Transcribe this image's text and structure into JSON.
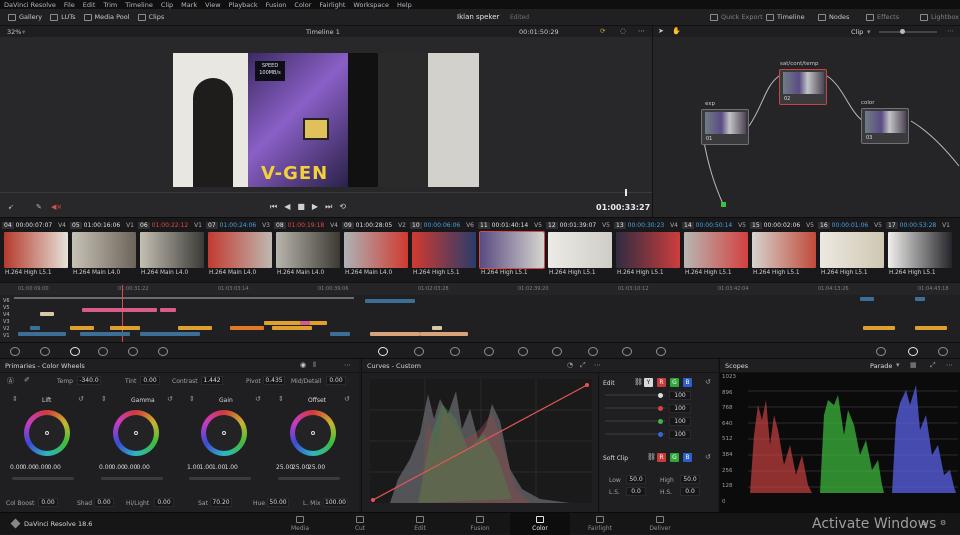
{
  "menu": [
    "DaVinci Resolve",
    "File",
    "Edit",
    "Trim",
    "Timeline",
    "Clip",
    "Mark",
    "View",
    "Playback",
    "Fusion",
    "Color",
    "Fairlight",
    "Workspace",
    "Help"
  ],
  "toolbar": {
    "gallery": "Gallery",
    "luts": "LUTs",
    "media_pool": "Media Pool",
    "clips": "Clips",
    "project_name": "Iklan speker",
    "project_status": "Edited",
    "quick_export": "Quick Export",
    "timeline": "Timeline",
    "nodes": "Nodes",
    "effects": "Effects",
    "lightbox": "Lightbox"
  },
  "viewer": {
    "zoom": "32%",
    "timeline_name": "Timeline 1",
    "timecode": "00:01:50:29",
    "playhead_timecode": "01:00:33:27",
    "video_text": {
      "speed": "SPEED",
      "speed_val": "100MB/s",
      "brand": "V-GEN"
    }
  },
  "nodes": {
    "mode": "Clip",
    "items": [
      {
        "name": "exp",
        "label": "01"
      },
      {
        "name": "sat/cont/temp",
        "label": "02"
      },
      {
        "name": "color",
        "label": "03"
      }
    ]
  },
  "clips": [
    {
      "num": "04",
      "tc": "00:00:07:07",
      "track": "V4",
      "codec": "H.264 High L5.1",
      "tc_color": "#e0e0e0"
    },
    {
      "num": "05",
      "tc": "01:00:16:06",
      "track": "V1",
      "codec": "H.264 Main L4.0",
      "tc_color": "#e0e0e0"
    },
    {
      "num": "06",
      "tc": "01:00:22:12",
      "track": "V1",
      "codec": "H.264 Main L4.0",
      "tc_color": "#e24a4a"
    },
    {
      "num": "07",
      "tc": "01:00:24:06",
      "track": "V3",
      "codec": "H.264 Main L4.0",
      "tc_color": "#4aa3e2"
    },
    {
      "num": "08",
      "tc": "01:00:19:18",
      "track": "V4",
      "codec": "H.264 Main L4.0",
      "tc_color": "#e24a4a"
    },
    {
      "num": "09",
      "tc": "01:00:28:05",
      "track": "V2",
      "codec": "H.264 Main L4.0",
      "tc_color": "#e0e0e0"
    },
    {
      "num": "10",
      "tc": "00:00:06:06",
      "track": "V6",
      "codec": "H.264 High L5.1",
      "tc_color": "#4aa3e2"
    },
    {
      "num": "11",
      "tc": "00:01:40:14",
      "track": "V5",
      "codec": "H.264 High L5.1",
      "tc_color": "#e0e0e0"
    },
    {
      "num": "12",
      "tc": "00:01:39:07",
      "track": "V5",
      "codec": "H.264 High L5.1",
      "tc_color": "#e0e0e0"
    },
    {
      "num": "13",
      "tc": "00:00:30:23",
      "track": "V4",
      "codec": "H.264 High L5.1",
      "tc_color": "#4aa3e2"
    },
    {
      "num": "14",
      "tc": "00:00:50:14",
      "track": "V5",
      "codec": "H.264 High L5.1",
      "tc_color": "#4aa3e2"
    },
    {
      "num": "15",
      "tc": "00:00:02:06",
      "track": "V5",
      "codec": "H.264 High L5.1",
      "tc_color": "#e0e0e0"
    },
    {
      "num": "16",
      "tc": "00:00:01:06",
      "track": "V5",
      "codec": "H.264 High L5.1",
      "tc_color": "#4aa3e2"
    },
    {
      "num": "17",
      "tc": "00:00:53:28",
      "track": "V1",
      "codec": "H.264 High L5.1",
      "tc_color": "#4aa3e2"
    }
  ],
  "timeline_ruler": [
    "01:00:09:00",
    "01:00:31:22",
    "01:03:03:14",
    "01:00:39:06",
    "01:02:03:28",
    "01:02:39:20",
    "01:03:10:12",
    "01:03:42:04",
    "01:04:13:26",
    "01:04:43:18"
  ],
  "tracks": [
    "V6",
    "V5",
    "V4",
    "V3",
    "V2",
    "V1"
  ],
  "primaries": {
    "title": "Primaries - Color Wheels",
    "temp_label": "Temp",
    "temp": "-340.0",
    "tint_label": "Tint",
    "tint": "0.00",
    "contrast_label": "Contrast",
    "contrast": "1.442",
    "pivot_label": "Pivot",
    "pivot": "0.435",
    "mid_label": "Mid/Detail",
    "mid": "0.00",
    "wheels": [
      {
        "name": "Lift",
        "vals": [
          "0.00",
          "0.00",
          "0.00",
          "0.00"
        ]
      },
      {
        "name": "Gamma",
        "vals": [
          "0.00",
          "0.00",
          "0.00",
          "0.00"
        ]
      },
      {
        "name": "Gain",
        "vals": [
          "1.00",
          "1.00",
          "1.00",
          "1.00"
        ]
      },
      {
        "name": "Offset",
        "vals": [
          "25.00",
          "25.00",
          "25.00"
        ]
      }
    ],
    "col_boost_label": "Col Boost",
    "col_boost": "0.00",
    "shad_label": "Shad",
    "shad": "0.00",
    "hl_label": "Hi/Light",
    "hl": "0.00",
    "sat_label": "Sat",
    "sat": "70.20",
    "hue_label": "Hue",
    "hue": "50.00",
    "lmix_label": "L. Mix",
    "lmix": "100.00"
  },
  "curves": {
    "title": "Curves - Custom",
    "edit_label": "Edit",
    "channel_values": [
      "100",
      "100",
      "100",
      "100"
    ],
    "soft_clip_label": "Soft Clip",
    "low_label": "Low",
    "low": "50.0",
    "high_label": "High",
    "high": "50.0",
    "ls_label": "L.S.",
    "ls": "0.0",
    "hs_label": "H.S.",
    "hs": "0.0"
  },
  "scopes": {
    "title": "Scopes",
    "mode": "Parade",
    "scale": [
      "1023",
      "896",
      "768",
      "640",
      "512",
      "384",
      "256",
      "128",
      "0"
    ]
  },
  "pages": [
    "Media",
    "Cut",
    "Edit",
    "Fusion",
    "Color",
    "Fairlight",
    "Deliver"
  ],
  "active_page": "Color",
  "app_name": "DaVinci Resolve 18.6",
  "watermark": "Activate Windows"
}
